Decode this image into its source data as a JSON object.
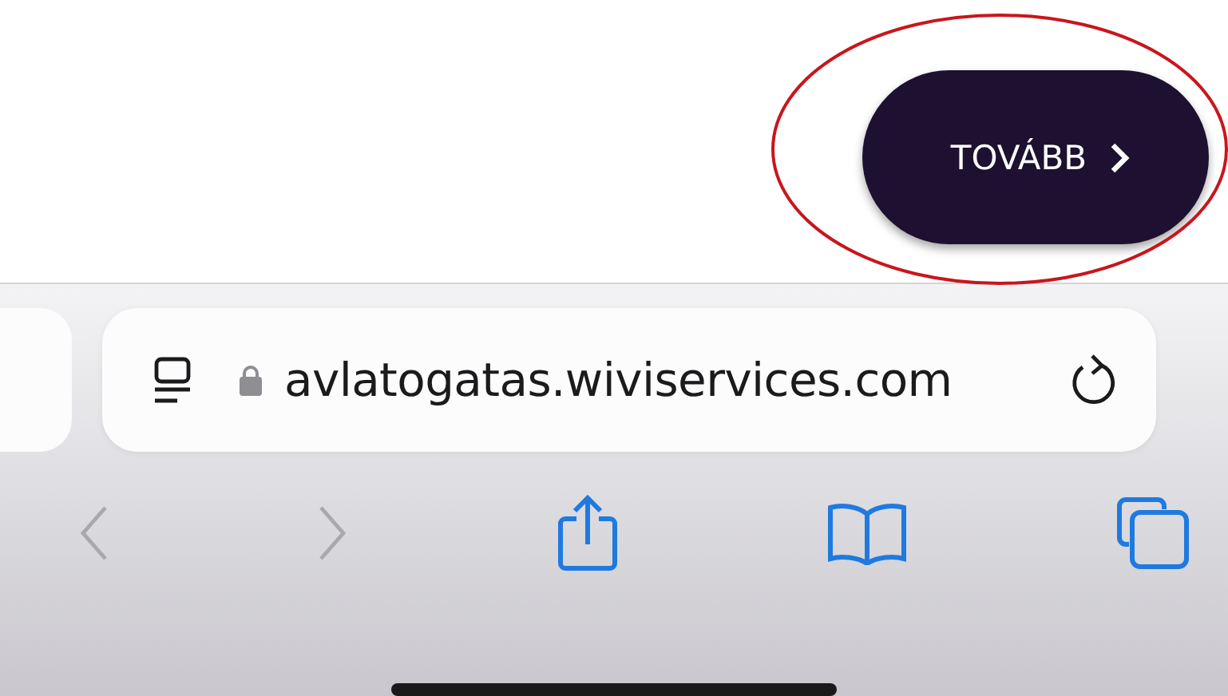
{
  "page": {
    "next_button": {
      "label": "TOVÁBB",
      "highlighted": true
    }
  },
  "address_bar": {
    "url": "avlatogatas.wiviservices.com"
  },
  "toolbar": [
    {
      "kind": "back",
      "disabled": true
    },
    {
      "kind": "forward",
      "disabled": true
    },
    {
      "kind": "share",
      "disabled": false
    },
    {
      "kind": "bookmarks",
      "disabled": false
    },
    {
      "kind": "tabs",
      "disabled": false
    }
  ]
}
